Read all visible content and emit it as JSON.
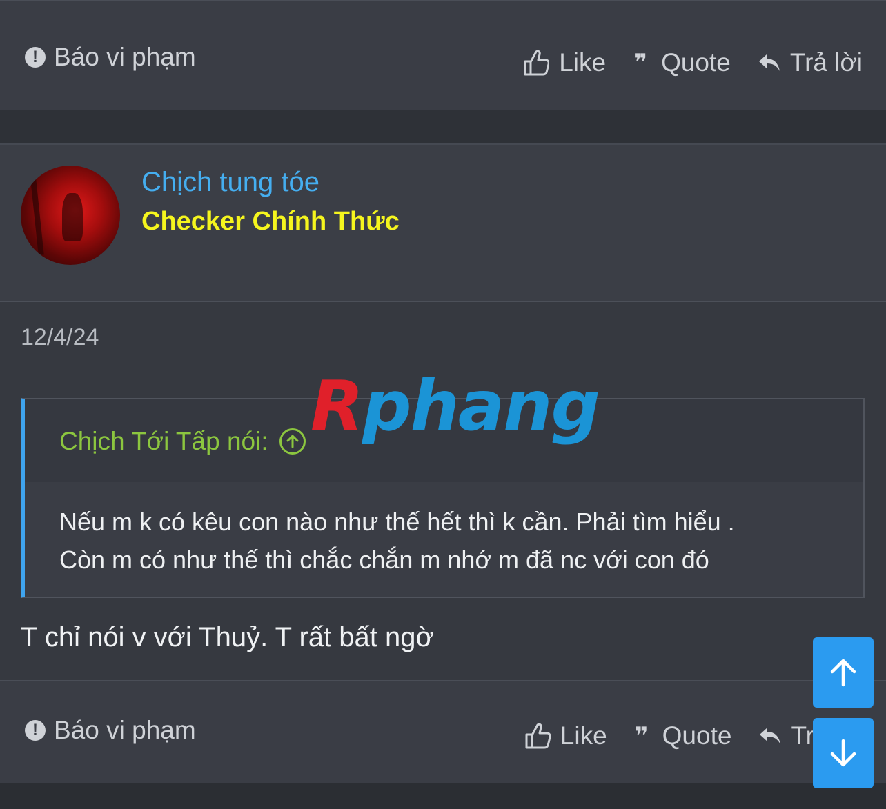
{
  "prev_footer": {
    "report_label": "Báo vi phạm",
    "like_label": "Like",
    "quote_label": "Quote",
    "reply_label": "Trả lời"
  },
  "post": {
    "username": "Chịch tung tóe",
    "user_title": "Checker Chính Thức",
    "date": "12/4/24",
    "quote": {
      "author": "Chịch Tới Tấp nói:",
      "lines": [
        "Nếu m k có kêu con nào như thế hết thì k cần. Phải tìm hiểu .",
        "Còn m có như thế thì chắc chắn m nhớ m đã nc với con đó"
      ]
    },
    "message": "T chỉ nói v với Thuỷ. T rất bất ngờ",
    "footer": {
      "report_label": "Báo vi phạm",
      "like_label": "Like",
      "quote_label": "Quote",
      "reply_label": "Tr"
    }
  },
  "watermark": {
    "first": "R",
    "rest": "phang"
  },
  "colors": {
    "username": "#45aef0",
    "user_title": "#f5f51e",
    "quote_author": "#8cc63f",
    "quote_accent": "#3fa4ee",
    "scroll_button": "#2b9bf0"
  },
  "icons": {
    "report": "exclamation-circle-icon",
    "like": "thumbs-up-icon",
    "quote": "quote-icon",
    "reply": "reply-arrow-icon",
    "quote_jump": "arrow-up-circle-icon",
    "scroll_up": "arrow-up-icon",
    "scroll_down": "arrow-down-icon"
  }
}
